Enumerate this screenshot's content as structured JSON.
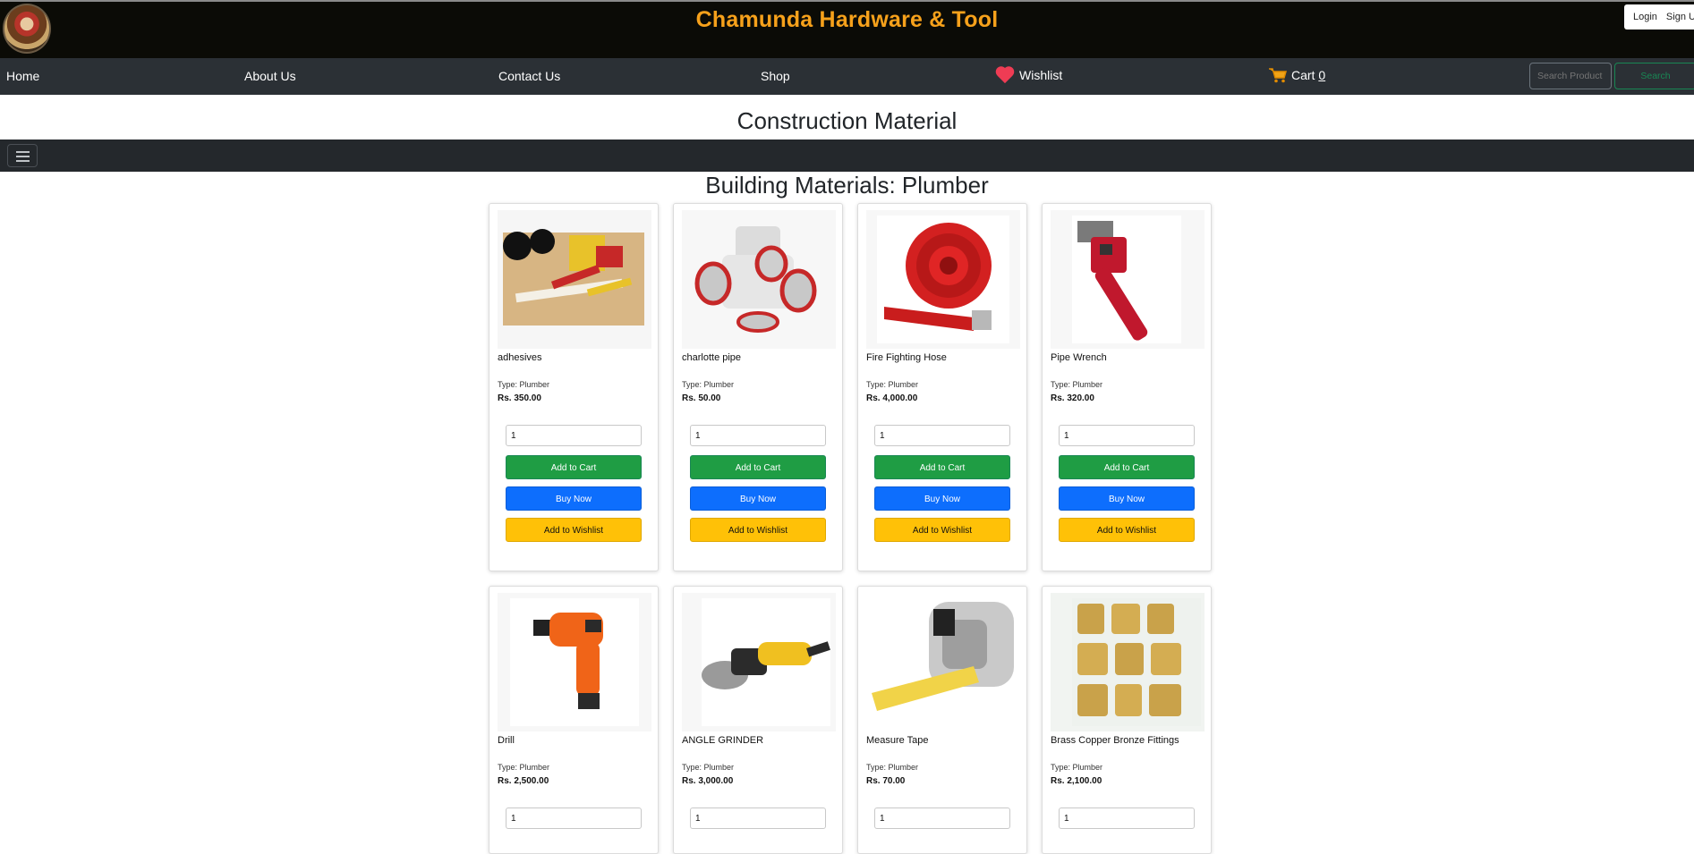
{
  "header": {
    "site_title": "Chamunda Hardware & Tool",
    "login": "Login",
    "signup": "Sign Up"
  },
  "nav": {
    "home": "Home",
    "about": "About Us",
    "contact": "Contact Us",
    "shop": "Shop",
    "wishlist": "Wishlist",
    "cart_label": "Cart",
    "cart_count": "0",
    "search_placeholder": "Search Product",
    "search_button": "Search"
  },
  "page_title": "Construction Material",
  "section_title": "Building Materials: Plumber",
  "buttons": {
    "add_to_cart": "Add to Cart",
    "buy_now": "Buy Now",
    "add_to_wishlist": "Add to Wishlist"
  },
  "products": [
    {
      "name": "adhesives",
      "type": "Type: Plumber",
      "price": "Rs. 350.00",
      "qty": "1",
      "image": "adhesives-photo"
    },
    {
      "name": "charlotte pipe",
      "type": "Type: Plumber",
      "price": "Rs. 50.00",
      "qty": "1",
      "image": "pipe-fitting-photo"
    },
    {
      "name": "Fire Fighting Hose",
      "type": "Type: Plumber",
      "price": "Rs. 4,000.00",
      "qty": "1",
      "image": "fire-hose-photo"
    },
    {
      "name": "Pipe Wrench",
      "type": "Type: Plumber",
      "price": "Rs. 320.00",
      "qty": "1",
      "image": "pipe-wrench-photo"
    },
    {
      "name": "Drill",
      "type": "Type: Plumber",
      "price": "Rs. 2,500.00",
      "qty": "1",
      "image": "drill-photo"
    },
    {
      "name": "ANGLE GRINDER",
      "type": "Type: Plumber",
      "price": "Rs. 3,000.00",
      "qty": "1",
      "image": "angle-grinder-photo"
    },
    {
      "name": "Measure Tape",
      "type": "Type: Plumber",
      "price": "Rs. 70.00",
      "qty": "1",
      "image": "measure-tape-photo"
    },
    {
      "name": "Brass Copper Bronze Fittings",
      "type": "Type: Plumber",
      "price": "Rs. 2,100.00",
      "qty": "1",
      "image": "brass-fittings-photo"
    }
  ],
  "colors": {
    "title_orange": "#f6a11b",
    "add_to_cart_green": "#1f9d44",
    "buy_now_blue": "#0d6efd",
    "wishlist_yellow": "#ffc107",
    "heart_red": "#ef3c54"
  }
}
